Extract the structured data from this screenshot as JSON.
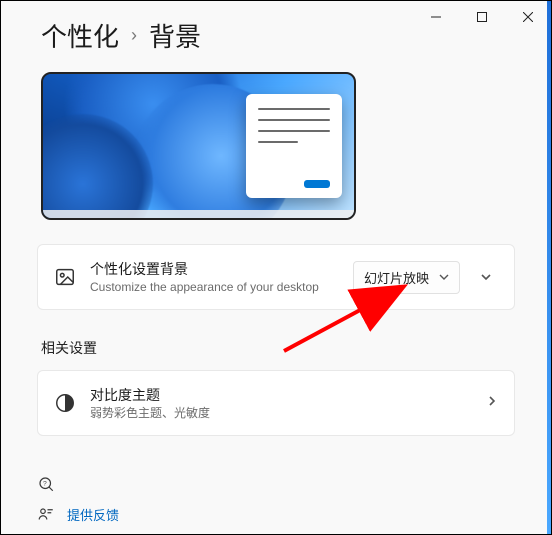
{
  "breadcrumb": {
    "parent": "个性化",
    "current": "背景"
  },
  "personalize": {
    "title": "个性化设置背景",
    "subtitle": "Customize the appearance of your desktop",
    "dropdown_value": "幻灯片放映"
  },
  "related": {
    "heading": "相关设置",
    "contrast": {
      "title": "对比度主题",
      "subtitle": "弱势彩色主题、光敏度"
    }
  },
  "footer": {
    "feedback": "提供反馈"
  }
}
